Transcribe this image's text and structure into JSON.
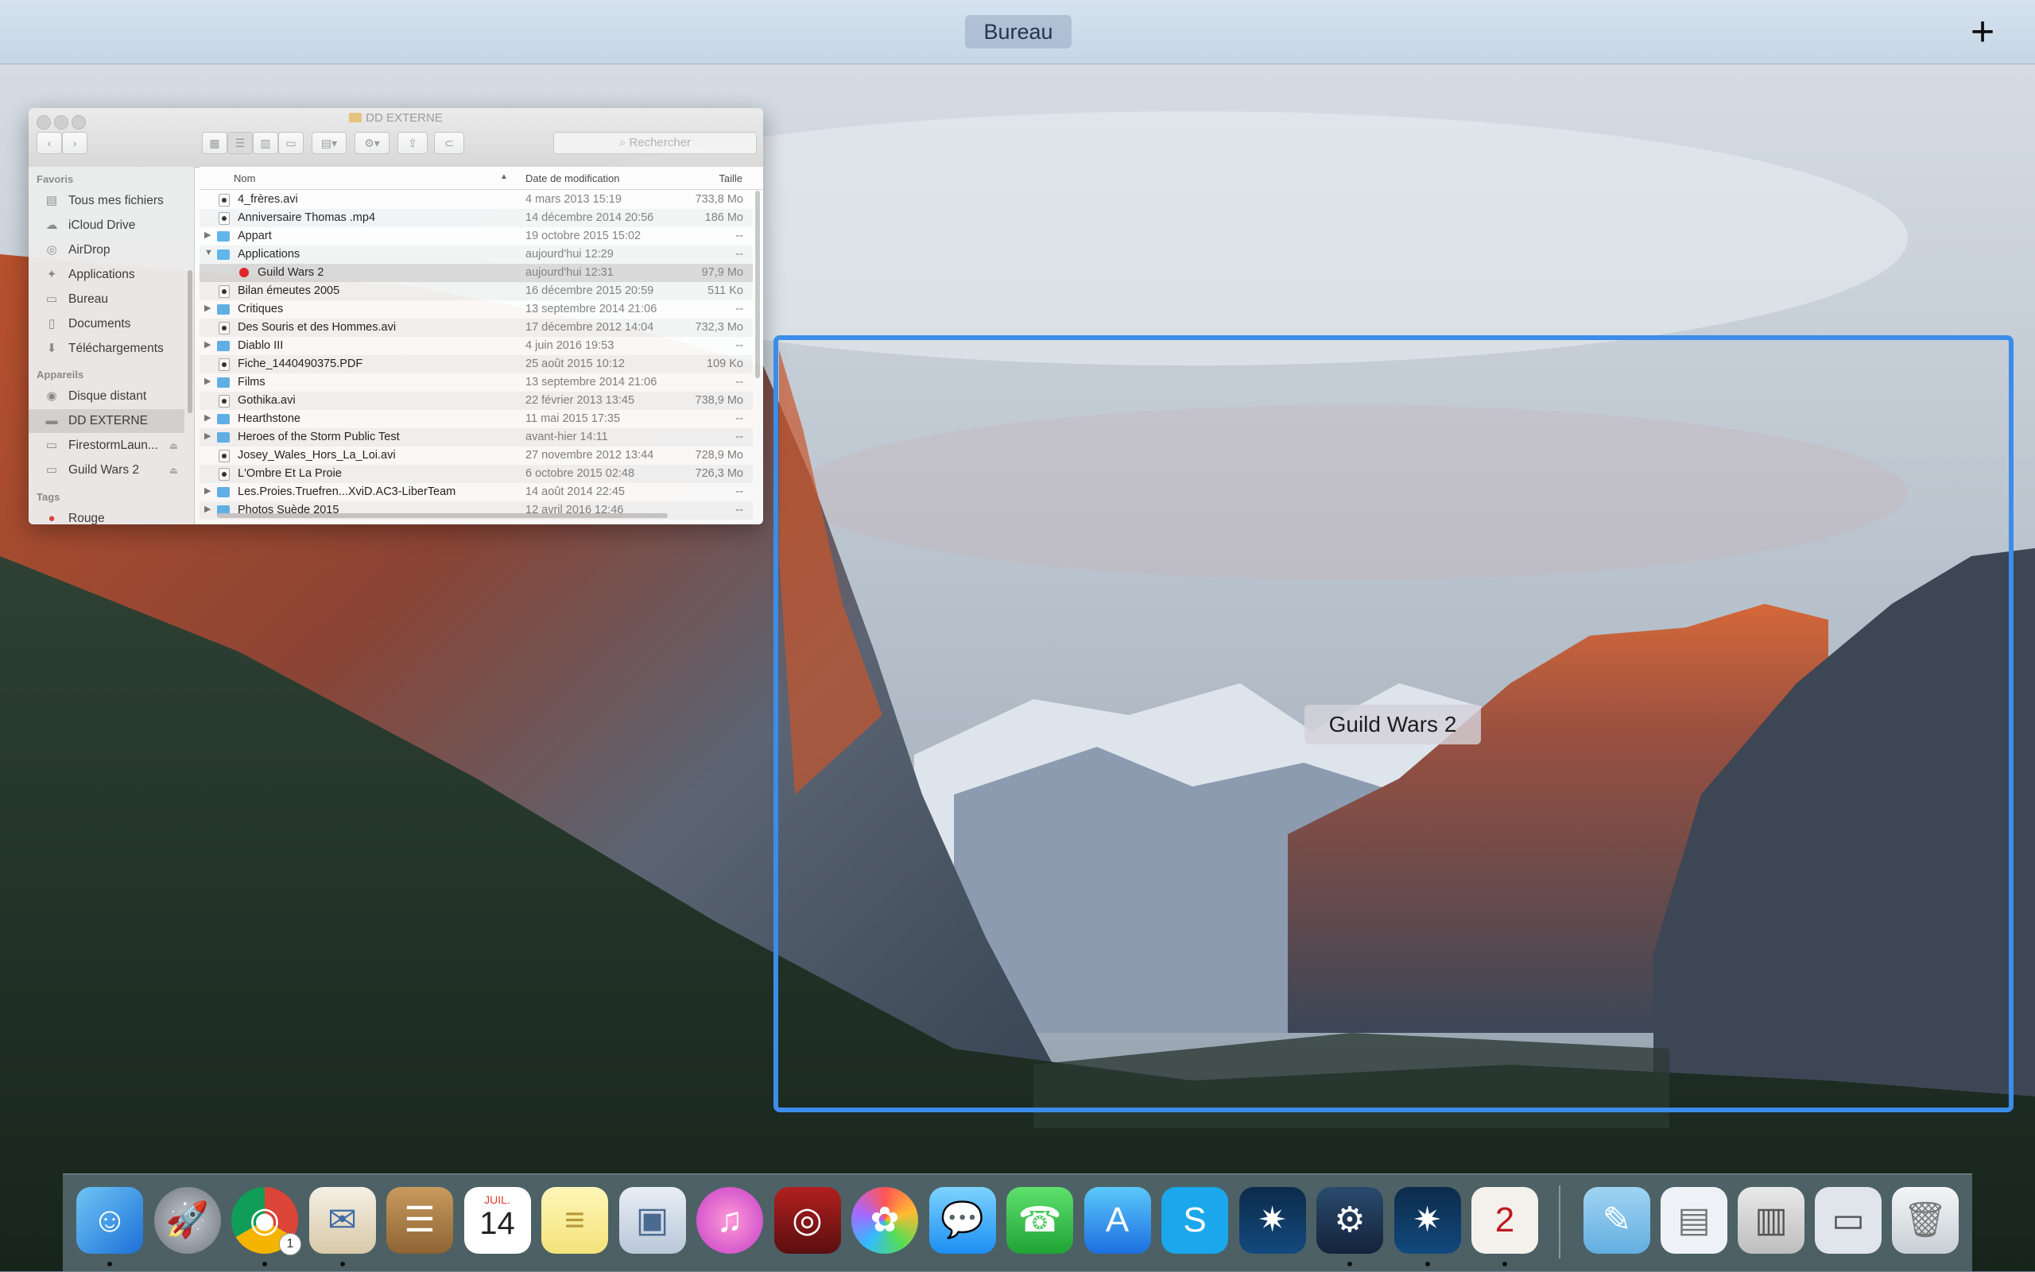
{
  "spaces_bar": {
    "space_label": "Bureau",
    "add_label": "+"
  },
  "finder": {
    "title": "DD EXTERNE",
    "search_placeholder": "Rechercher",
    "sidebar": {
      "favorites_header": "Favoris",
      "favorites": [
        {
          "label": "Tous mes fichiers",
          "icon": "all-files-icon"
        },
        {
          "label": "iCloud Drive",
          "icon": "cloud-icon"
        },
        {
          "label": "AirDrop",
          "icon": "airdrop-icon"
        },
        {
          "label": "Applications",
          "icon": "applications-icon"
        },
        {
          "label": "Bureau",
          "icon": "desktop-icon"
        },
        {
          "label": "Documents",
          "icon": "documents-icon"
        },
        {
          "label": "Téléchargements",
          "icon": "downloads-icon"
        }
      ],
      "devices_header": "Appareils",
      "devices": [
        {
          "label": "Disque distant",
          "icon": "disc-icon"
        },
        {
          "label": "DD EXTERNE",
          "icon": "drive-icon",
          "selected": true
        },
        {
          "label": "FirestormLaun...",
          "icon": "drive-icon",
          "eject": true
        },
        {
          "label": "Guild Wars 2",
          "icon": "drive-icon",
          "eject": true
        }
      ],
      "tags_header": "Tags",
      "tags": [
        {
          "label": "Rouge",
          "color": "#e0443e"
        }
      ]
    },
    "columns": {
      "name": "Nom",
      "date": "Date de modification",
      "size": "Taille"
    },
    "rows": [
      {
        "name": "4_frères.avi",
        "date": "4 mars 2013 15:19",
        "size": "733,8 Mo",
        "kind": "file"
      },
      {
        "name": "Anniversaire Thomas .mp4",
        "date": "14 décembre 2014 20:56",
        "size": "186 Mo",
        "kind": "file"
      },
      {
        "name": "Appart",
        "date": "19 octobre 2015 15:02",
        "size": "--",
        "kind": "folder"
      },
      {
        "name": "Applications",
        "date": "aujourd'hui 12:29",
        "size": "--",
        "kind": "folder",
        "expanded": true
      },
      {
        "name": "Guild Wars 2",
        "date": "aujourd'hui 12:31",
        "size": "97,9 Mo",
        "kind": "app",
        "child": true,
        "selected": true
      },
      {
        "name": "Bilan émeutes 2005",
        "date": "16 décembre 2015 20:59",
        "size": "511 Ko",
        "kind": "file"
      },
      {
        "name": "Critiques",
        "date": "13 septembre 2014 21:06",
        "size": "--",
        "kind": "folder"
      },
      {
        "name": "Des Souris et des Hommes.avi",
        "date": "17 décembre 2012 14:04",
        "size": "732,3 Mo",
        "kind": "file"
      },
      {
        "name": "Diablo III",
        "date": "4 juin 2016 19:53",
        "size": "--",
        "kind": "folder"
      },
      {
        "name": "Fiche_1440490375.PDF",
        "date": "25 août 2015 10:12",
        "size": "109 Ko",
        "kind": "file"
      },
      {
        "name": "Films",
        "date": "13 septembre 2014 21:06",
        "size": "--",
        "kind": "folder"
      },
      {
        "name": "Gothika.avi",
        "date": "22 février 2013 13:45",
        "size": "738,9 Mo",
        "kind": "file"
      },
      {
        "name": "Hearthstone",
        "date": "11 mai 2015 17:35",
        "size": "--",
        "kind": "folder"
      },
      {
        "name": "Heroes of the Storm Public Test",
        "date": "avant-hier 14:11",
        "size": "--",
        "kind": "folder"
      },
      {
        "name": "Josey_Wales_Hors_La_Loi.avi",
        "date": "27 novembre 2012 13:44",
        "size": "728,9 Mo",
        "kind": "file"
      },
      {
        "name": "L'Ombre Et La Proie",
        "date": "6 octobre 2015 02:48",
        "size": "726,3 Mo",
        "kind": "file"
      },
      {
        "name": "Les.Proies.Truefren...XviD.AC3-LiberTeam",
        "date": "14 août 2014 22:45",
        "size": "--",
        "kind": "folder"
      },
      {
        "name": "Photos Suède 2015",
        "date": "12 avril 2016 12:46",
        "size": "--",
        "kind": "folder"
      }
    ]
  },
  "selected_window": {
    "label": "Guild Wars 2",
    "highlight_color": "#3b8de9"
  },
  "dock": {
    "apps": [
      {
        "name": "finder",
        "glyph": "☺",
        "running": true
      },
      {
        "name": "launchpad",
        "glyph": "🚀",
        "running": false
      },
      {
        "name": "chrome",
        "glyph": "◉",
        "running": true,
        "badge": "1"
      },
      {
        "name": "mail",
        "glyph": "✉",
        "running": true
      },
      {
        "name": "contacts",
        "glyph": "☰",
        "running": false
      },
      {
        "name": "calendar",
        "glyph": "14",
        "month": "JUIL.",
        "running": false
      },
      {
        "name": "notes",
        "glyph": "≡",
        "running": false
      },
      {
        "name": "preview",
        "glyph": "▣",
        "running": false
      },
      {
        "name": "itunes",
        "glyph": "♫",
        "running": false
      },
      {
        "name": "photo-booth",
        "glyph": "◎",
        "running": false
      },
      {
        "name": "photos",
        "glyph": "✿",
        "running": false
      },
      {
        "name": "messages",
        "glyph": "💬",
        "running": false
      },
      {
        "name": "facetime",
        "glyph": "☎",
        "running": false
      },
      {
        "name": "app-store",
        "glyph": "A",
        "running": false
      },
      {
        "name": "skype",
        "glyph": "S",
        "running": false
      },
      {
        "name": "battle-net",
        "glyph": "✷",
        "running": false
      },
      {
        "name": "steam",
        "glyph": "⚙",
        "running": true
      },
      {
        "name": "battle-net-2",
        "glyph": "✷",
        "running": true
      },
      {
        "name": "guild-wars-2",
        "glyph": "2",
        "running": true
      }
    ],
    "stacks": [
      {
        "name": "notes-folder",
        "glyph": "✎"
      },
      {
        "name": "documents-stack",
        "glyph": "▤"
      },
      {
        "name": "downloads-stack",
        "glyph": "▥"
      },
      {
        "name": "browser-window",
        "glyph": "▭"
      },
      {
        "name": "trash",
        "glyph": "🗑"
      }
    ]
  }
}
